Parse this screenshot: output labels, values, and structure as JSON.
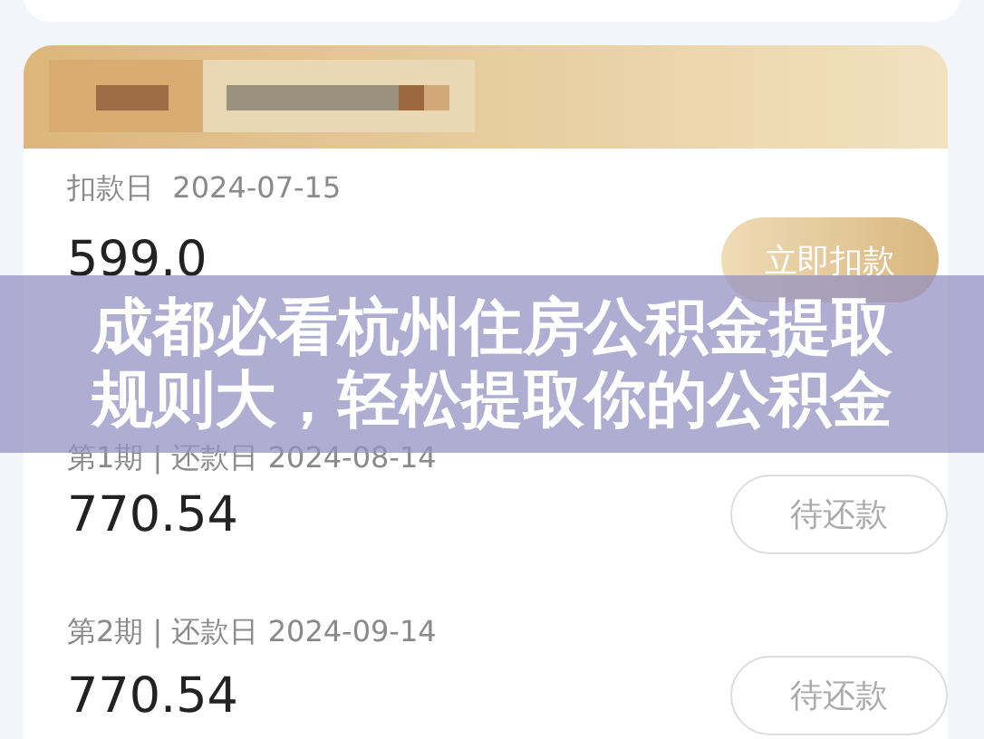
{
  "payment": {
    "label": "扣款日",
    "date": "2024-07-15",
    "amount": "599.0",
    "button": "立即扣款"
  },
  "installments": [
    {
      "label": "第1期 | 还款日 2024-08-14",
      "amount": "770.54",
      "status": "待还款"
    },
    {
      "label": "第2期 | 还款日 2024-09-14",
      "amount": "770.54",
      "status": "待还款"
    }
  ],
  "banner": {
    "lines": [
      "成都必看杭州住房公积金提取",
      "规则大，轻松提取你的公积金"
    ]
  }
}
